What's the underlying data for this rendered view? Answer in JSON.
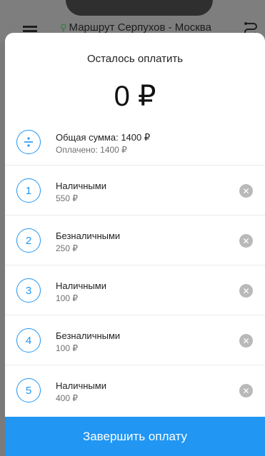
{
  "background": {
    "route_text": "Маршрут Серпухов - Москва"
  },
  "sheet": {
    "remaining_label": "Осталось оплатить",
    "remaining_amount": "0 ₽",
    "summary": {
      "icon": "divide-icon",
      "total": "Общая сумма: 1400 ₽",
      "paid": "Оплачено: 1400 ₽"
    },
    "payments": [
      {
        "number": "1",
        "method": "Наличными",
        "amount": "550 ₽"
      },
      {
        "number": "2",
        "method": "Безналичными",
        "amount": "250 ₽"
      },
      {
        "number": "3",
        "method": "Наличными",
        "amount": "100 ₽"
      },
      {
        "number": "4",
        "method": "Безналичными",
        "amount": "100 ₽"
      },
      {
        "number": "5",
        "method": "Наличными",
        "amount": "400 ₽"
      }
    ],
    "finish_label": "Завершить оплату"
  },
  "colors": {
    "accent": "#2196f3",
    "remove_icon": "#b9b9b9"
  }
}
